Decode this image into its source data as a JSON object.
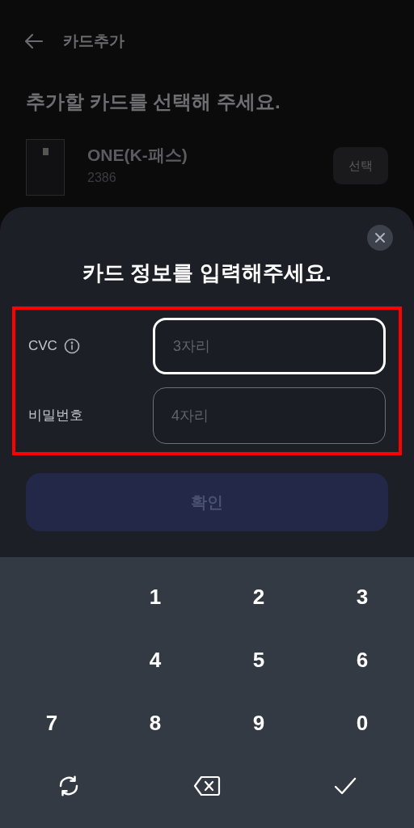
{
  "header": {
    "title": "카드추가"
  },
  "heading": "추가할 카드를 선택해 주세요.",
  "cards": [
    {
      "name": "ONE(K-패스)",
      "number": "2386",
      "action": "선택"
    }
  ],
  "sheet": {
    "title": "카드 정보를 입력해주세요.",
    "fields": [
      {
        "label": "CVC",
        "info": true,
        "placeholder": "3자리",
        "focused": true
      },
      {
        "label": "비밀번호",
        "info": false,
        "placeholder": "4자리",
        "focused": false
      }
    ],
    "highlighted": true,
    "confirm": {
      "label": "확인",
      "disabled": true
    }
  },
  "keypad": {
    "rows": [
      [
        {
          "kind": "blank"
        },
        {
          "kind": "digit",
          "label": "1"
        },
        {
          "kind": "digit",
          "label": "2"
        },
        {
          "kind": "digit",
          "label": "3"
        }
      ],
      [
        {
          "kind": "blank"
        },
        {
          "kind": "digit",
          "label": "4"
        },
        {
          "kind": "digit",
          "label": "5"
        },
        {
          "kind": "digit",
          "label": "6"
        }
      ],
      [
        {
          "kind": "digit",
          "label": "7"
        },
        {
          "kind": "digit",
          "label": "8"
        },
        {
          "kind": "digit",
          "label": "9"
        },
        {
          "kind": "digit",
          "label": "0"
        }
      ],
      [
        {
          "kind": "refresh"
        },
        {
          "kind": "backspace"
        },
        {
          "kind": "done"
        }
      ]
    ]
  }
}
